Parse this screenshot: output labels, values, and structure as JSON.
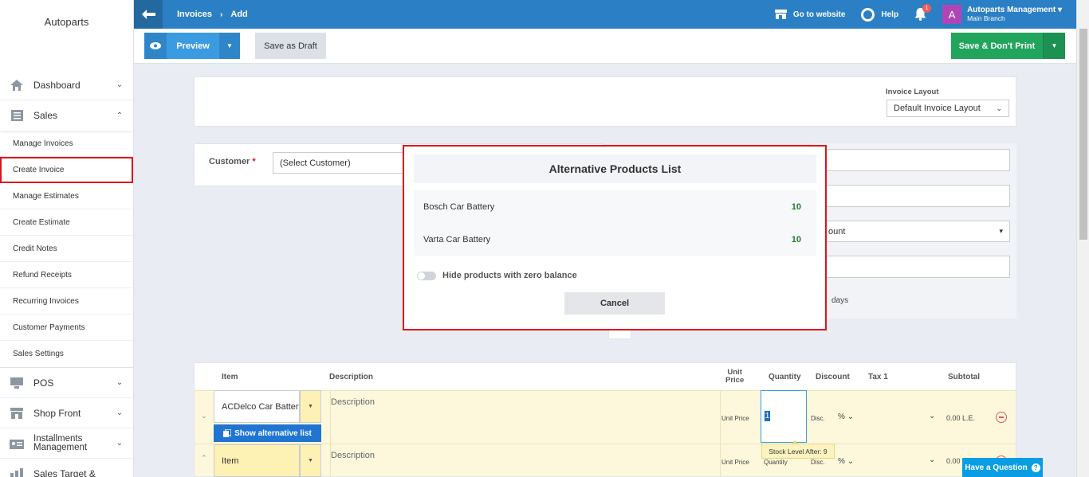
{
  "sidebar": {
    "brand": "Autoparts",
    "items_top": [
      {
        "label": "Dashboard",
        "icon": "home-icon",
        "expanded": false
      },
      {
        "label": "Sales",
        "icon": "list-icon",
        "expanded": true
      }
    ],
    "sales_sub": [
      "Manage Invoices",
      "Create Invoice",
      "Manage Estimates",
      "Create Estimate",
      "Credit Notes",
      "Refund Receipts",
      "Recurring Invoices",
      "Customer Payments",
      "Sales Settings"
    ],
    "items_bottom": [
      {
        "label": "POS",
        "icon": "monitor-icon"
      },
      {
        "label": "Shop Front",
        "icon": "store-icon"
      },
      {
        "label": "Installments Management",
        "line1": "Installments",
        "line2": "Management",
        "icon": "contacts-icon"
      },
      {
        "label": "Sales Target &",
        "icon": "target-icon"
      }
    ],
    "active_sub": "Create Invoice"
  },
  "topbar": {
    "crumb1": "Invoices",
    "crumb2": "Add",
    "go_website": "Go to website",
    "help": "Help",
    "notif_count": "1",
    "avatar_letter": "A",
    "account_name": "Autoparts Management",
    "branch": "Main Branch"
  },
  "toolbar": {
    "preview": "Preview",
    "save_draft": "Save as Draft",
    "save_no_print": "Save & Don't Print"
  },
  "form": {
    "invoice_layout_label": "Invoice Layout",
    "invoice_layout_value": "Default Invoice Layout",
    "customer_label": "Customer",
    "customer_required": "*",
    "customer_value": "(Select Customer)",
    "discount_select_partial": "ount",
    "days": "days"
  },
  "table": {
    "headers": {
      "item": "Item",
      "description": "Description",
      "unit_price_1": "Unit",
      "unit_price_2": "Price",
      "quantity": "Quantity",
      "discount": "Discount",
      "tax": "Tax 1",
      "subtotal": "Subtotal"
    },
    "rows": [
      {
        "item": "ACDelco Car Battery",
        "description_placeholder": "Description",
        "unit_price_placeholder": "Unit Price",
        "quantity": "1",
        "disc_placeholder": "Disc.",
        "disc_type": "%",
        "subtotal": "0.00 L.E."
      },
      {
        "item": "Item",
        "description_placeholder": "Description",
        "unit_price_placeholder": "Unit Price",
        "quantity_placeholder": "Quantity",
        "disc_placeholder": "Disc.",
        "disc_type": "%",
        "subtotal": "0.00 L.E."
      }
    ],
    "show_alternative": "Show alternative list",
    "stock_tooltip": "Stock Level After: 9"
  },
  "modal": {
    "title": "Alternative Products List",
    "products": [
      {
        "name": "Bosch Car Battery",
        "qty": "10"
      },
      {
        "name": "Varta Car Battery",
        "qty": "10"
      }
    ],
    "hide_zero": "Hide products with zero balance",
    "cancel": "Cancel"
  },
  "help_button": "Have a Question",
  "colors": {
    "topbar": "#2b7fc4",
    "save": "#21a55d",
    "preview": "#3a9be0",
    "highlight": "#e0121b",
    "stock_qty": "#1e7b33"
  }
}
